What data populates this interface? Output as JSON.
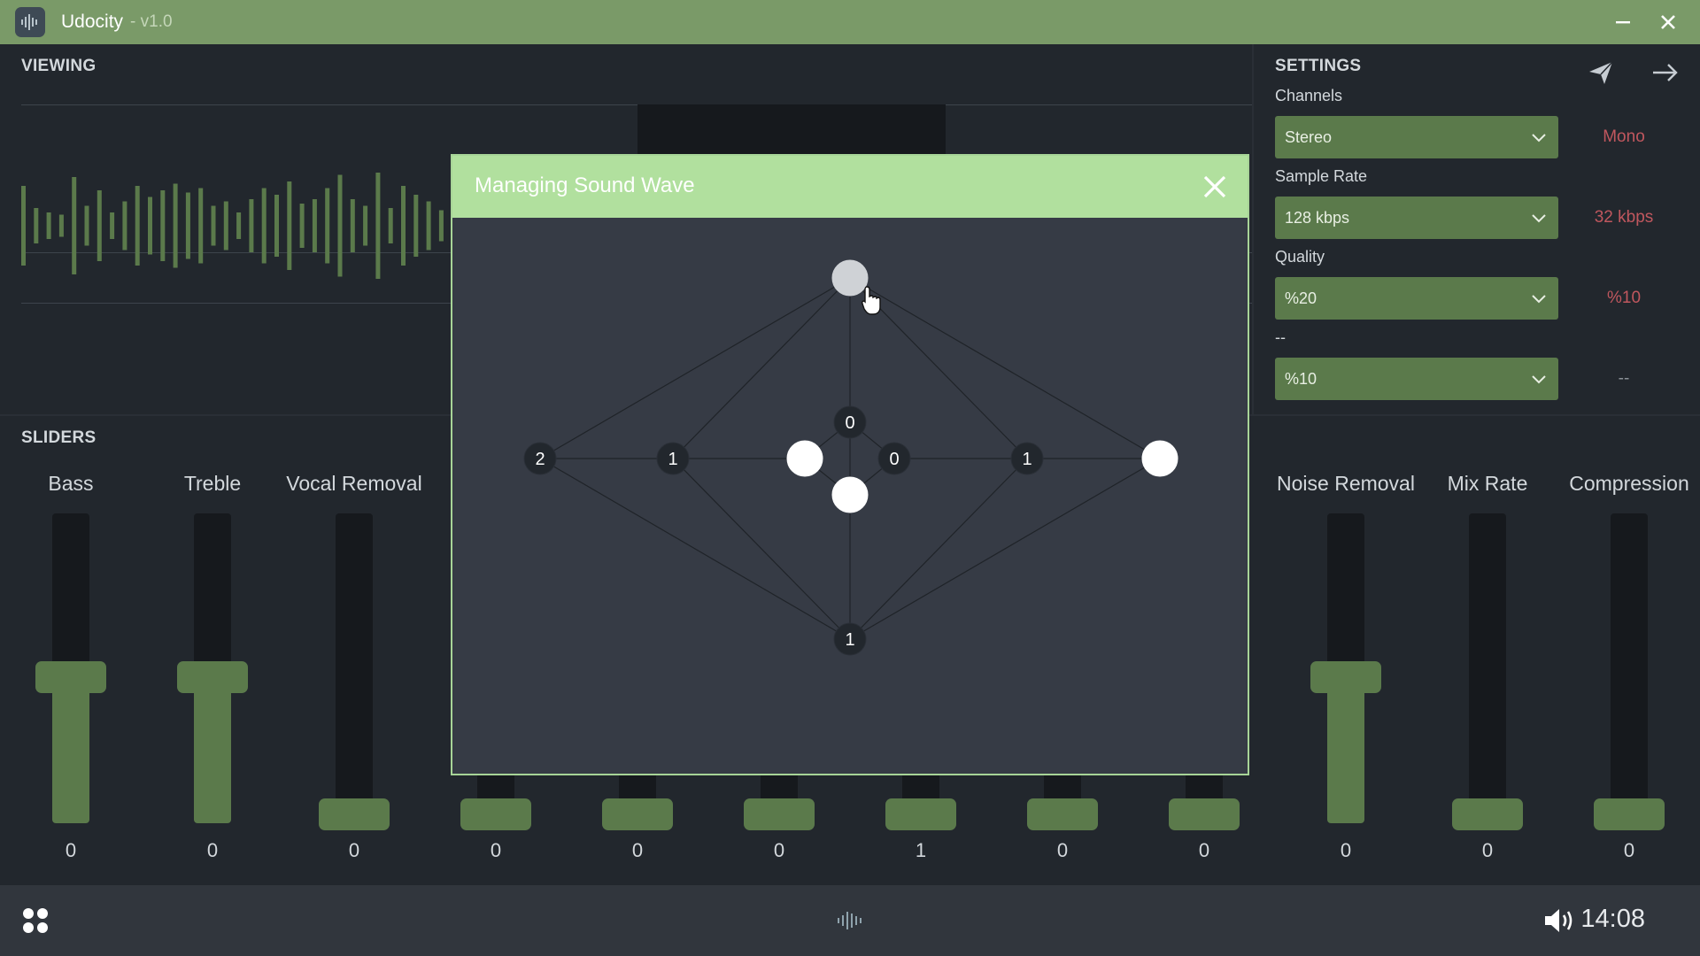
{
  "app": {
    "title": "Udocity",
    "version": "- v1.0"
  },
  "viewing": {
    "title": "VIEWING"
  },
  "settings": {
    "title": "SETTINGS",
    "rows": [
      {
        "label": "Channels",
        "value": "Stereo",
        "alt": "Mono"
      },
      {
        "label": "Sample Rate",
        "value": "128 kbps",
        "alt": "32 kbps"
      },
      {
        "label": "Quality",
        "value": "%20",
        "alt": "%10"
      },
      {
        "label": "--",
        "value": "%10",
        "alt": "--"
      }
    ]
  },
  "sliders": {
    "title": "SLIDERS",
    "items": [
      {
        "label": "Bass",
        "value": "0",
        "level": 0.5
      },
      {
        "label": "Treble",
        "value": "0",
        "level": 0.5
      },
      {
        "label": "Vocal Removal",
        "value": "0",
        "level": 0.0
      },
      {
        "label": "",
        "value": "0",
        "level": 0.0
      },
      {
        "label": "",
        "value": "0",
        "level": 0.0
      },
      {
        "label": "",
        "value": "0",
        "level": 0.0
      },
      {
        "label": "",
        "value": "1",
        "level": 0.0
      },
      {
        "label": "",
        "value": "0",
        "level": 0.0
      },
      {
        "label": "",
        "value": "0",
        "level": 0.0
      },
      {
        "label": "Noise Removal",
        "value": "0",
        "level": 0.5
      },
      {
        "label": "Mix Rate",
        "value": "0",
        "level": 0.0
      },
      {
        "label": "Compression",
        "value": "0",
        "level": 0.0
      }
    ]
  },
  "dialog": {
    "title": "Managing Sound Wave",
    "nodes": [
      {
        "id": "top",
        "label": "",
        "style": "selected"
      },
      {
        "id": "mid-top",
        "label": "0",
        "style": "dark"
      },
      {
        "id": "far-left",
        "label": "2",
        "style": "dark"
      },
      {
        "id": "left",
        "label": "1",
        "style": "dark"
      },
      {
        "id": "center-left",
        "label": "",
        "style": "white"
      },
      {
        "id": "center-right",
        "label": "0",
        "style": "dark"
      },
      {
        "id": "right",
        "label": "1",
        "style": "dark"
      },
      {
        "id": "far-right",
        "label": "",
        "style": "white"
      },
      {
        "id": "mid-bottom",
        "label": "",
        "style": "white"
      },
      {
        "id": "bottom",
        "label": "1",
        "style": "dark"
      }
    ]
  },
  "taskbar": {
    "time": "14:08"
  },
  "colors": {
    "accent": "#5b7a4b",
    "titlebar": "#7a9a68",
    "dialog_header": "#b1e09e",
    "alt_value": "#c0575e"
  },
  "icons": [
    "waveform-icon",
    "minimize-icon",
    "close-icon",
    "send-icon",
    "arrow-right-icon",
    "chevron-down-icon",
    "apps-grid-icon",
    "volume-icon",
    "hand-cursor-icon"
  ]
}
